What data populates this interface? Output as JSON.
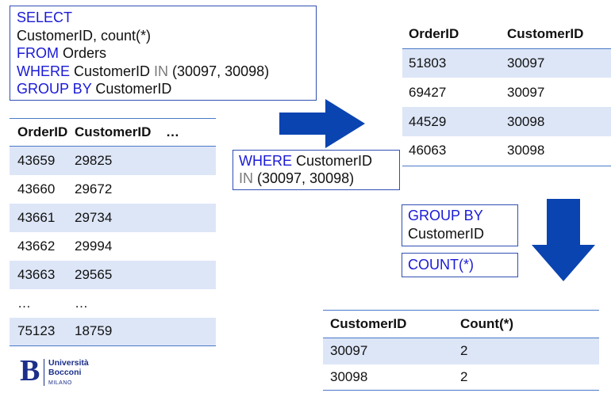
{
  "sql_box": {
    "line1_kw": "SELECT",
    "line2": "CustomerID, count(*)",
    "line3_kw": "FROM",
    "line3_rest": " Orders",
    "line4_kw": "WHERE",
    "line4_mid": " CustomerID ",
    "line4_op": "IN",
    "line4_rest": " (30097, 30098)",
    "line5_kw": "GROUP BY",
    "line5_rest": " CustomerID"
  },
  "orders_table": {
    "headers": [
      "OrderID",
      "CustomerID",
      "…"
    ],
    "rows": [
      [
        "43659",
        "29825"
      ],
      [
        "43660",
        "29672"
      ],
      [
        "43661",
        "29734"
      ],
      [
        "43662",
        "29994"
      ],
      [
        "43663",
        "29565"
      ],
      [
        "…",
        "…"
      ],
      [
        "75123",
        "18759"
      ]
    ]
  },
  "where_box": {
    "kw": "WHERE",
    "rest": " CustomerID",
    "op": "IN",
    "vals": " (30097, 30098)"
  },
  "filtered_table": {
    "headers": [
      "OrderID",
      "CustomerID"
    ],
    "rows": [
      [
        "51803",
        "30097"
      ],
      [
        "69427",
        "30097"
      ],
      [
        "44529",
        "30098"
      ],
      [
        "46063",
        "30098"
      ]
    ]
  },
  "groupby_box": {
    "kw": "GROUP BY",
    "rest": "CustomerID"
  },
  "count_box": {
    "kw": "COUNT(*)"
  },
  "result_table": {
    "headers": [
      "CustomerID",
      "Count(*)"
    ],
    "rows": [
      [
        "30097",
        "2"
      ],
      [
        "30098",
        "2"
      ]
    ]
  },
  "logo": {
    "line1": "Università",
    "line2": "Bocconi",
    "line3": "MILANO",
    "mark": "B"
  },
  "colors": {
    "keyword": "#1a1ad6",
    "border": "#2f4fb3",
    "rule": "#4a78c8",
    "shade": "#dde6f7",
    "arrow": "#0a44b0"
  }
}
